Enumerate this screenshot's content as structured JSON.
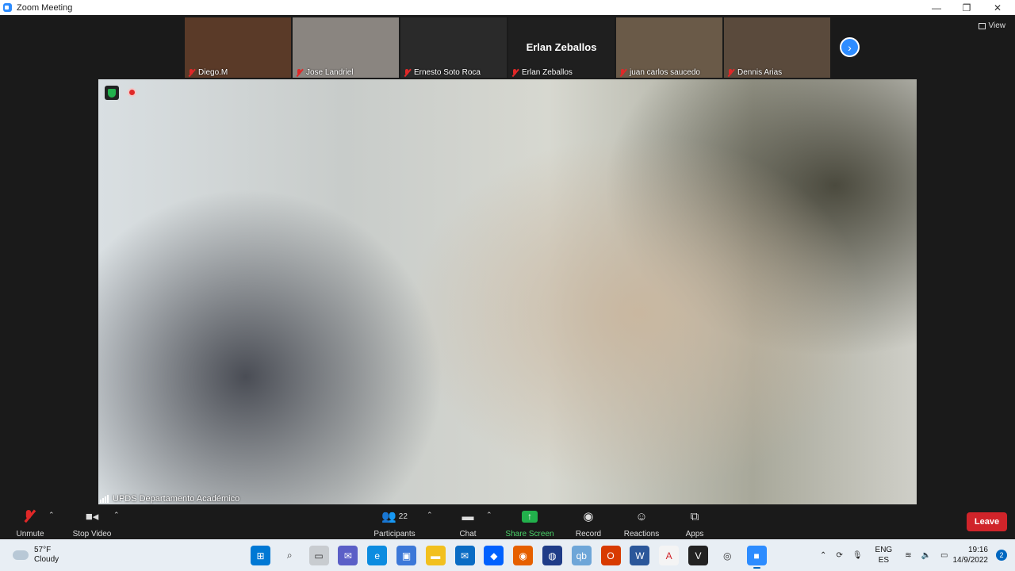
{
  "window": {
    "title": "Zoom Meeting",
    "controls": [
      "—",
      "❐",
      "✕"
    ]
  },
  "gallery": {
    "tiles": [
      {
        "name": "Diego.M",
        "bg": "#5a3a28"
      },
      {
        "name": "Jose Landriel",
        "bg": "#8a8580"
      },
      {
        "name": "Ernesto Soto Roca",
        "bg": "#2a2a2a"
      },
      {
        "name": "Erlan Zeballos",
        "bg": "#1f1f1f",
        "big_name": "Erlan Zeballos"
      },
      {
        "name": "juan carlos saucedo",
        "bg": "#6a5a48"
      },
      {
        "name": "Dennis Arias",
        "bg": "#5a4a3c"
      }
    ],
    "next_icon": "chevron-right-icon",
    "view_label": "View"
  },
  "main_video": {
    "speaker_label": "UPDS Departamento Académico"
  },
  "toolbar": {
    "unmute": "Unmute",
    "stop_video": "Stop Video",
    "participants": "Participants",
    "participants_count": "22",
    "chat": "Chat",
    "share_screen": "Share Screen",
    "record": "Record",
    "reactions": "Reactions",
    "apps": "Apps",
    "leave": "Leave",
    "colors": {
      "share_green": "#22b14c",
      "leave_red": "#d0242a",
      "accent_blue": "#2d8cff"
    }
  },
  "taskbar": {
    "weather_temp": "57°F",
    "weather_desc": "Cloudy",
    "apps": [
      {
        "name": "windows-start-icon",
        "color": "#0078d4",
        "glyph": "⊞"
      },
      {
        "name": "search-icon",
        "color": "#e8eef4",
        "glyph": "⌕"
      },
      {
        "name": "task-view-icon",
        "color": "#c8ccd0",
        "glyph": "▭"
      },
      {
        "name": "teams-chat-icon",
        "color": "#5b5fc7",
        "glyph": "✉"
      },
      {
        "name": "edge-icon",
        "color": "#0c8ce0",
        "glyph": "e"
      },
      {
        "name": "store-icon",
        "color": "#3c78d8",
        "glyph": "▣"
      },
      {
        "name": "file-explorer-icon",
        "color": "#f2c01e",
        "glyph": "▬"
      },
      {
        "name": "mail-icon",
        "color": "#0a6cc4",
        "glyph": "✉"
      },
      {
        "name": "dropbox-icon",
        "color": "#0061fe",
        "glyph": "◆"
      },
      {
        "name": "firefox-icon",
        "color": "#e66000",
        "glyph": "◉"
      },
      {
        "name": "app-icon",
        "color": "#1f3c88",
        "glyph": "◍"
      },
      {
        "name": "qb-icon",
        "color": "#6ea6d8",
        "glyph": "qb"
      },
      {
        "name": "office-icon",
        "color": "#d83b01",
        "glyph": "O"
      },
      {
        "name": "word-icon",
        "color": "#2b579a",
        "glyph": "W"
      },
      {
        "name": "acrobat-icon",
        "color": "#f4f4f4",
        "glyph": "A"
      },
      {
        "name": "vivaldi-icon",
        "color": "#222222",
        "glyph": "V"
      },
      {
        "name": "obs-icon",
        "color": "#e8eef4",
        "glyph": "◎"
      },
      {
        "name": "zoom-icon",
        "color": "#2d8cff",
        "glyph": "■"
      }
    ],
    "lang_top": "ENG",
    "lang_bottom": "ES",
    "time": "19:16",
    "date": "14/9/2022",
    "notifications": "2"
  }
}
